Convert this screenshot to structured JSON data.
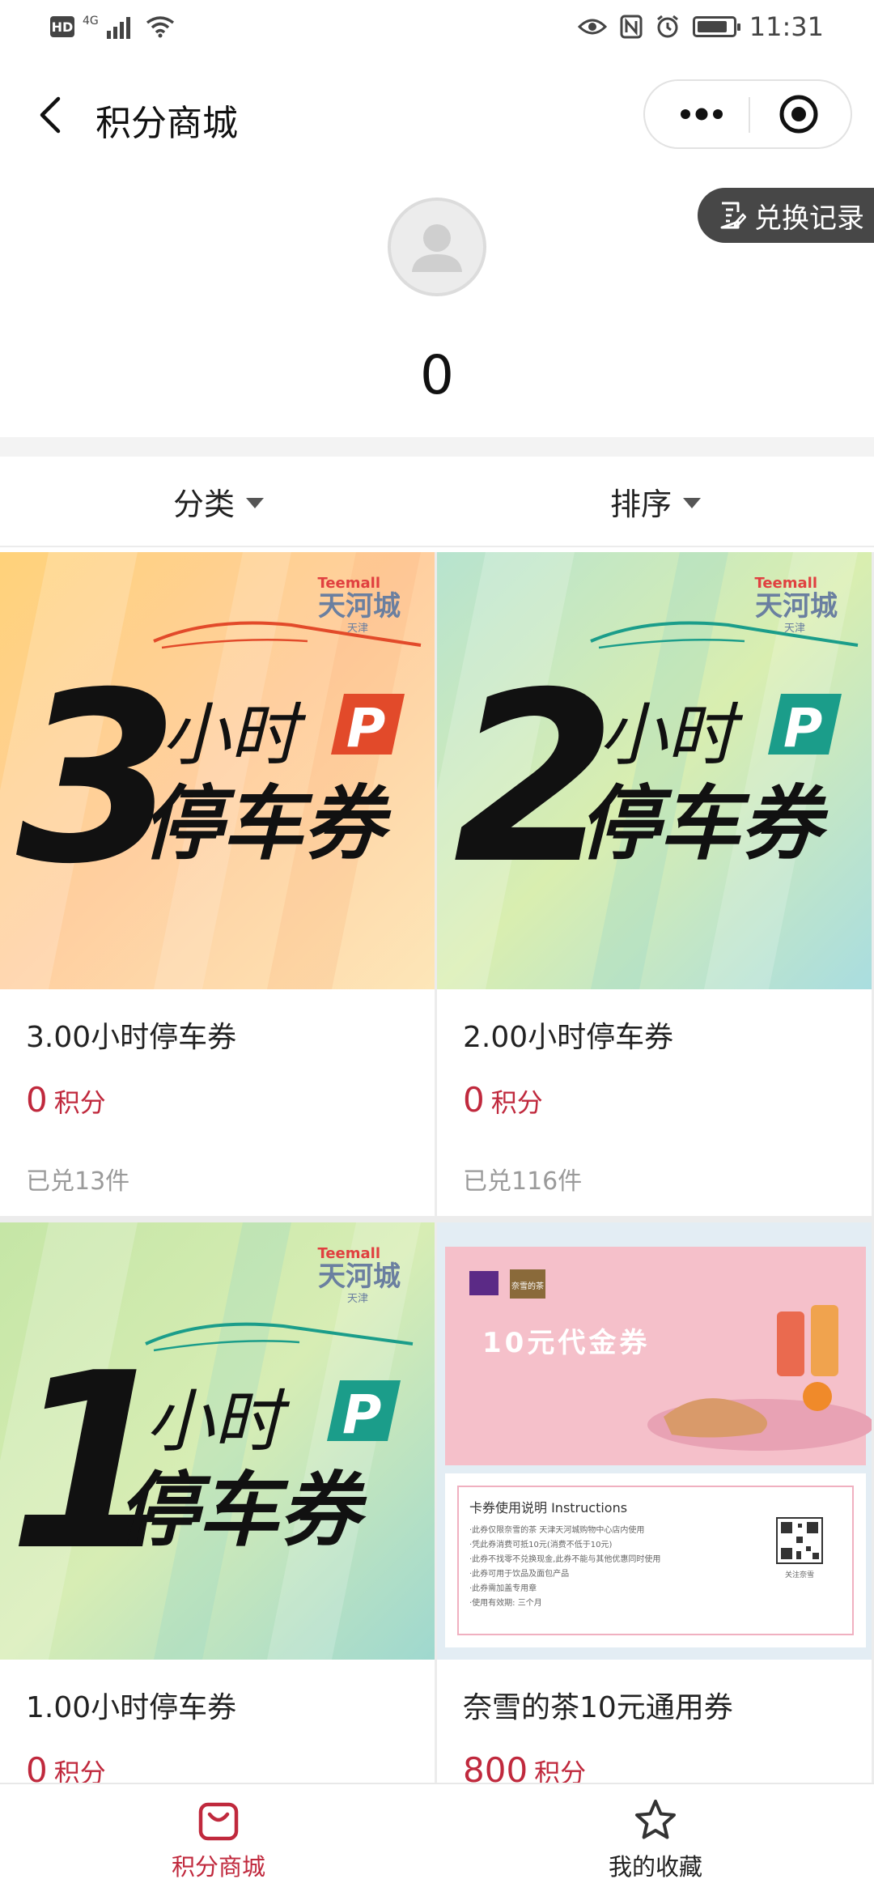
{
  "status_bar": {
    "hd": "HD",
    "network": "4G",
    "time": "11:31",
    "battery_level": 0.85
  },
  "nav": {
    "title": "积分商城"
  },
  "profile": {
    "records_label": "兑换记录",
    "points": "0"
  },
  "filters": {
    "category_label": "分类",
    "sort_label": "排序"
  },
  "products": [
    {
      "name": "3.00小时停车券",
      "price": "0",
      "unit": "积分",
      "redeemed": "已兑13件",
      "image": {
        "brand_en": "Teemall",
        "brand_cn": "天河城",
        "brand_sub": "天津",
        "number": "3",
        "line1": "小时",
        "line2": "停车券",
        "badge": "P"
      }
    },
    {
      "name": "2.00小时停车券",
      "price": "0",
      "unit": "积分",
      "redeemed": "已兑116件",
      "image": {
        "brand_en": "Teemall",
        "brand_cn": "天河城",
        "brand_sub": "天津",
        "number": "2",
        "line1": "小时",
        "line2": "停车券",
        "badge": "P"
      }
    },
    {
      "name": "1.00小时停车券",
      "price": "0",
      "unit": "积分",
      "redeemed": "",
      "image": {
        "brand_en": "Teemall",
        "brand_cn": "天河城",
        "brand_sub": "天津",
        "number": "1",
        "line1": "小时",
        "line2": "停车券",
        "badge": "P"
      }
    },
    {
      "name": "奈雪的茶10元通用券",
      "price": "800",
      "unit": "积分",
      "redeemed": "",
      "image": {
        "voucher_title": "10元代金券",
        "brand_box": "奈雪的茶",
        "instructions_title": "卡券使用说明 Instructions",
        "instructions": [
          "·此券仅限奈雪的茶 天津天河城购物中心店内使用",
          "·凭此券消费可抵10元(消费不低于10元)",
          "·此券不找零不兑换现金,此券不能与其他优惠同时使用",
          "·此券可用于饮品及面包产品",
          "·此券需加盖专用章",
          "·使用有效期: 三个月"
        ],
        "qr_caption": "关注奈雪"
      }
    }
  ],
  "tabs": [
    {
      "label": "积分商城",
      "icon": "shopping-bag-icon",
      "active": true
    },
    {
      "label": "我的收藏",
      "icon": "star-icon",
      "active": false
    }
  ],
  "colors": {
    "accent": "#c0293d",
    "dark_pill": "#474747"
  }
}
